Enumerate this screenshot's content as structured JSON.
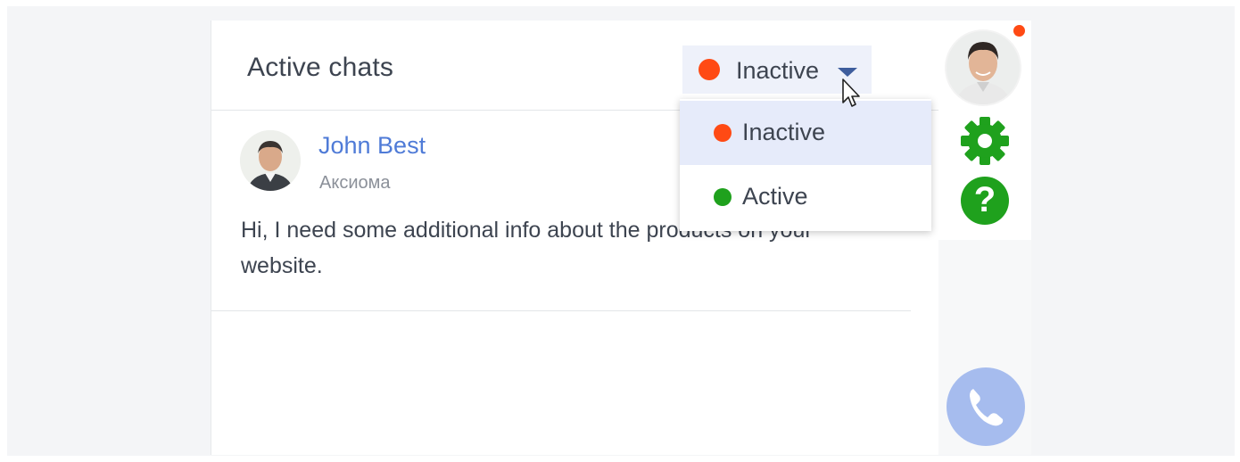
{
  "header": {
    "title": "Active chats",
    "status": {
      "current_label": "Inactive",
      "current_color": "#ff4a14"
    }
  },
  "dropdown": {
    "options": [
      {
        "label": "Inactive",
        "color": "#ff4a14",
        "highlighted": true
      },
      {
        "label": "Active",
        "color": "#1fa11d",
        "highlighted": false
      }
    ]
  },
  "chats": [
    {
      "name": "John Best",
      "company": "Аксиома",
      "message": "Hi, I need some additional info about the products on your website."
    }
  ],
  "sidebar": {
    "has_notification": true,
    "notification_color": "#ff4a14",
    "icons": [
      "user-avatar",
      "gear-icon",
      "help-icon"
    ],
    "help_glyph": "?",
    "accent_color": "#1fa11d"
  },
  "call_button": {
    "icon": "phone-icon",
    "color": "#a6bcee"
  },
  "colors": {
    "link": "#4f7bd7",
    "text": "#3d4450",
    "muted": "#8b9099",
    "selector_bg": "#eef1fa"
  }
}
